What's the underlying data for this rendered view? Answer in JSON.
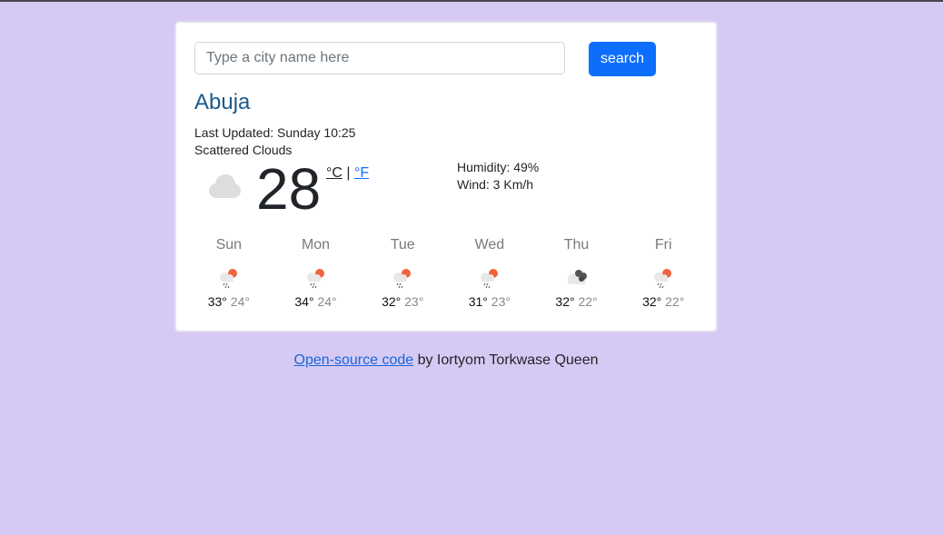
{
  "search": {
    "placeholder": "Type a city name here",
    "button_label": "search"
  },
  "current": {
    "city": "Abuja",
    "last_updated": "Last Updated: Sunday 10:25",
    "description": "Scattered Clouds",
    "temperature": "28",
    "icon": "cloud-icon",
    "unit_celsius": "°C",
    "unit_separator": "|",
    "unit_fahrenheit": "°F",
    "humidity": "Humidity: 49%",
    "wind": "Wind: 3 Km/h"
  },
  "forecast": [
    {
      "day": "Sun",
      "max": "33°",
      "min": "24°",
      "icon": "sun-rain-icon"
    },
    {
      "day": "Mon",
      "max": "34°",
      "min": "24°",
      "icon": "sun-rain-icon"
    },
    {
      "day": "Tue",
      "max": "32°",
      "min": "23°",
      "icon": "sun-rain-icon"
    },
    {
      "day": "Wed",
      "max": "31°",
      "min": "23°",
      "icon": "sun-rain-icon"
    },
    {
      "day": "Thu",
      "max": "32°",
      "min": "22°",
      "icon": "dark-clouds-icon"
    },
    {
      "day": "Fri",
      "max": "32°",
      "min": "22°",
      "icon": "sun-rain-icon"
    }
  ],
  "footer": {
    "link_text": "Open-source code",
    "text": " by Iortyom Torkwase Queen"
  },
  "colors": {
    "background": "#d6caf4",
    "button": "#0d6efd",
    "city": "#1a5a8c",
    "sun": "#f0643c"
  }
}
